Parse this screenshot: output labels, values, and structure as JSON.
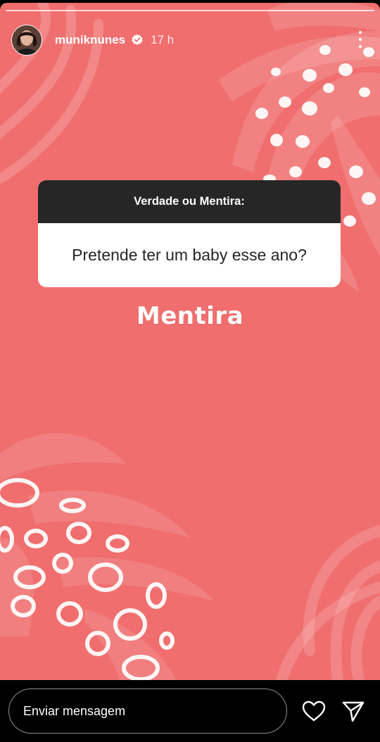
{
  "story": {
    "progress_segments": 1,
    "background_color": "#f06e6e",
    "card_header_color": "#262626"
  },
  "header": {
    "username": "muniknunes",
    "verified": true,
    "timestamp": "17 h",
    "avatar_icon": "profile-photo",
    "more_icon": "more-vertical-icon"
  },
  "question": {
    "title": "Verdade ou Mentira:",
    "text": "Pretende ter um baby esse ano?"
  },
  "answer": {
    "text": "Mentira"
  },
  "footer": {
    "message_placeholder": "Enviar mensagem",
    "like_icon": "heart-icon",
    "share_icon": "send-icon"
  }
}
